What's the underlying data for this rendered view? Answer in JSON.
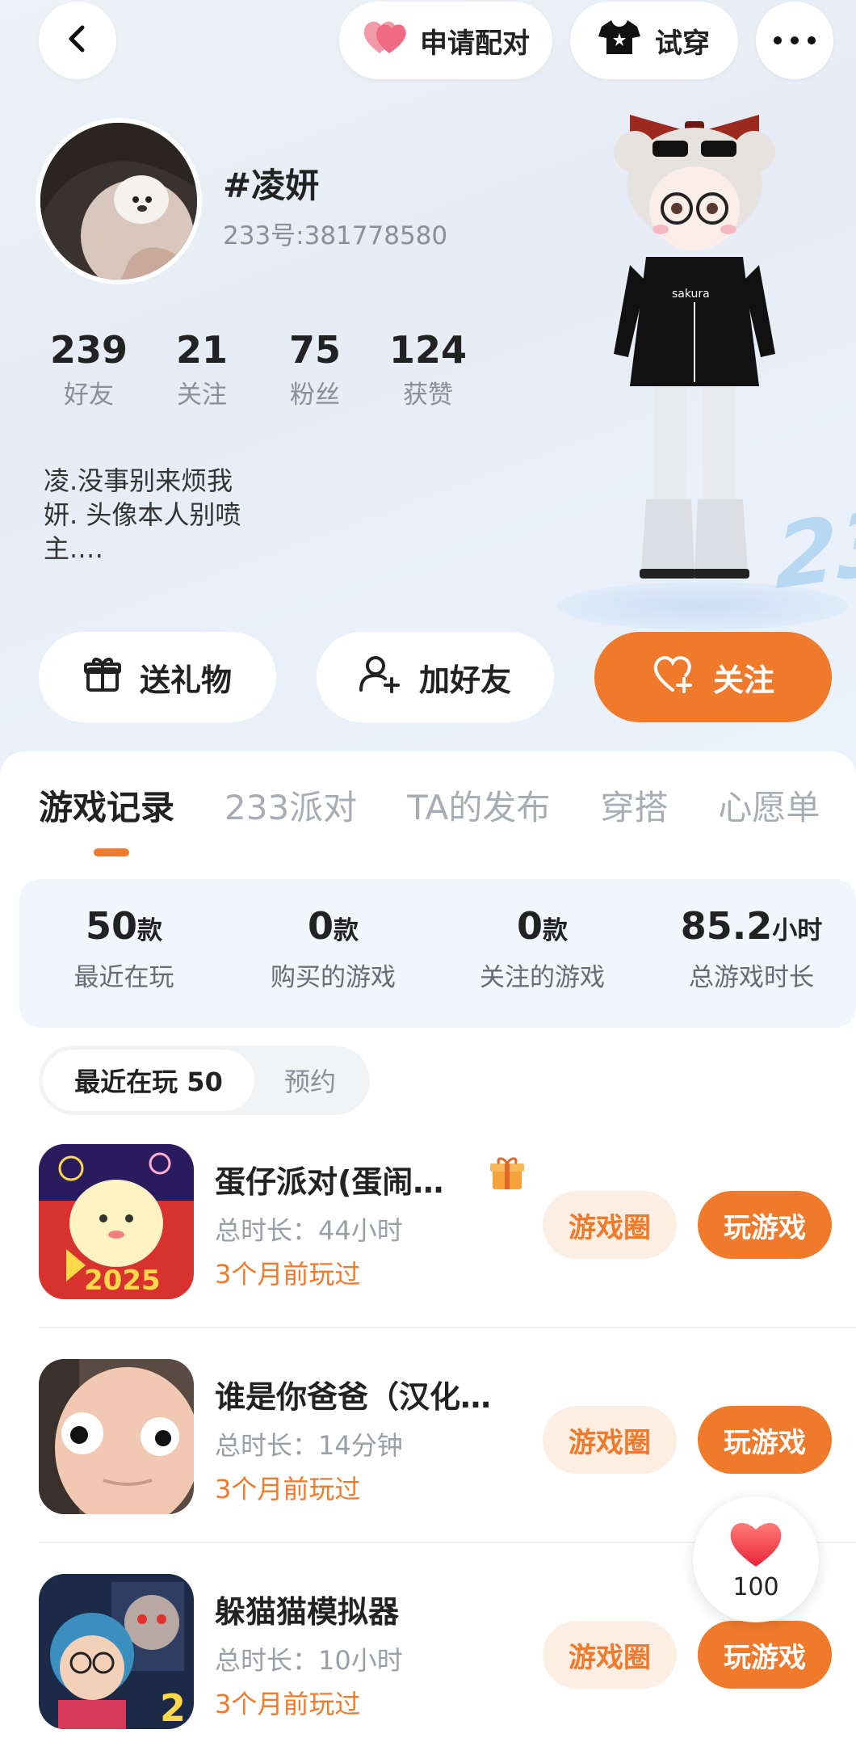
{
  "header": {
    "pair_label": "申请配对",
    "try_on_label": "试穿"
  },
  "profile": {
    "username": "#凌妍",
    "uid": "233号:381778580",
    "stats": [
      {
        "value": "239",
        "label": "好友"
      },
      {
        "value": "21",
        "label": "关注"
      },
      {
        "value": "75",
        "label": "粉丝"
      },
      {
        "value": "124",
        "label": "获赞"
      }
    ],
    "bio_lines": [
      "凌.没事别来烦我",
      "妍. 头像本人别喷",
      "主.…"
    ]
  },
  "actions": {
    "gift": "送礼物",
    "add_friend": "加好友",
    "follow": "关注"
  },
  "tabs": [
    "游戏记录",
    "233派对",
    "TA的发布",
    "穿搭",
    "心愿单"
  ],
  "summary": [
    {
      "value": "50",
      "unit": "款",
      "label": "最近在玩"
    },
    {
      "value": "0",
      "unit": "款",
      "label": "购买的游戏"
    },
    {
      "value": "0",
      "unit": "款",
      "label": "关注的游戏"
    },
    {
      "value": "85.2",
      "unit": "小时",
      "label": "总游戏时长"
    }
  ],
  "segment": {
    "recent": "最近在玩 50",
    "reserve": "预约"
  },
  "games": [
    {
      "title": "蛋仔派对(蛋闹…",
      "duration": "总时长：44小时",
      "last_played": "3个月前玩过",
      "circle": "游戏圈",
      "play": "玩游戏"
    },
    {
      "title": "谁是你爸爸（汉化…",
      "duration": "总时长：14分钟",
      "last_played": "3个月前玩过",
      "circle": "游戏圈",
      "play": "玩游戏"
    },
    {
      "title": "躲猫猫模拟器",
      "duration": "总时长：10小时",
      "last_played": "3个月前玩过",
      "circle": "游戏圈",
      "play": "玩游戏"
    }
  ],
  "like_float": {
    "count": "100"
  },
  "icons": {
    "back": "chevron-left-icon",
    "pair": "heart-icon",
    "try_on": "tshirt-icon",
    "more": "more-icon",
    "gift": "gift-icon",
    "add_friend": "add-user-icon",
    "follow": "heart-plus-icon",
    "gift_badge": "gift-badge-icon",
    "like": "heart-icon"
  },
  "colors": {
    "accent": "#f07a2c",
    "accent_light": "#fdeee3",
    "summary_bg": "#f2f5fb"
  }
}
